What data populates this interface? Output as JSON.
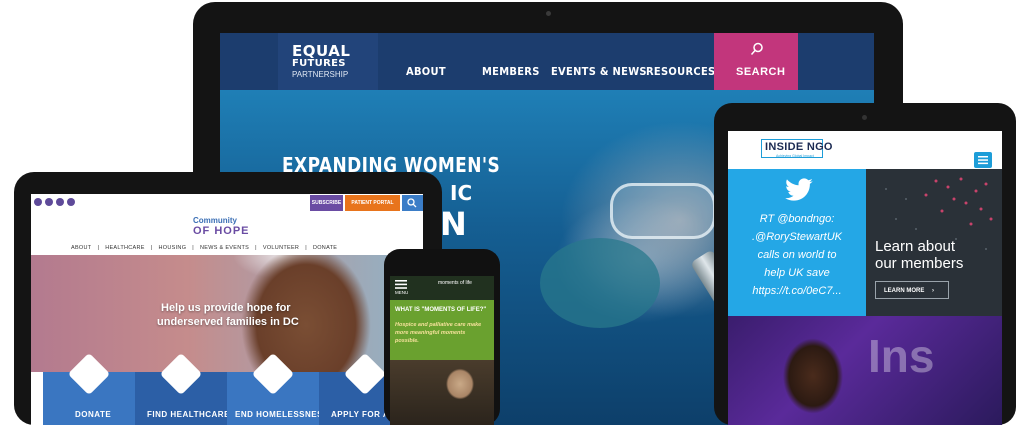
{
  "desktop": {
    "logo_line1": "EQUAL",
    "logo_line2": "FUTURES",
    "logo_line3": "PARTNERSHIP",
    "nav": [
      "ABOUT",
      "MEMBERS",
      "EVENTS & NEWS",
      "RESOURCES"
    ],
    "search_label": "SEARCH",
    "headline_line1": "EXPANDING WOMEN'S",
    "headline_line2": "IC",
    "headline_line3": "N",
    "colors": {
      "header": "#1c3d6e",
      "search": "#c2367c"
    }
  },
  "laptop": {
    "subscribe_label": "SUBSCRIBE",
    "portal_label": "PATIENT PORTAL",
    "logo_line1": "Community",
    "logo_line2": "OF HOPE",
    "nav": [
      "ABOUT",
      "|",
      "HEALTHCARE",
      "|",
      "HOUSING",
      "|",
      "NEWS & EVENTS",
      "|",
      "VOLUNTEER",
      "|",
      "DONATE"
    ],
    "headline_line1": "Help us provide hope for",
    "headline_line2": "underserved families in DC",
    "tiles": [
      {
        "label": "DONATE",
        "color": "#3a76c1"
      },
      {
        "label": "FIND HEALTHCARE",
        "color": "#2c5fa6"
      },
      {
        "label": "END HOMELESSNESS",
        "color": "#3a76c1"
      },
      {
        "label": "APPLY FOR A",
        "color": "#2c5fa6"
      }
    ]
  },
  "phone": {
    "menu_label": "MENU",
    "logo_text": "moments of life",
    "question": "WHAT IS \"MOMENTS OF LIFE?\"",
    "para_line1": "Hospice and palliative care make",
    "para_line2": "more meaningful moments",
    "para_line3": "possible."
  },
  "tablet": {
    "logo_text": "INSIDE NGO",
    "logo_sub": "Achieving Global Impact",
    "tweet_lines": [
      "RT @bondngo:",
      ".@RoryStewartUK",
      "calls on world to",
      "help UK save",
      "https://t.co/0eC7..."
    ],
    "learn_line1": "Learn about",
    "learn_line2": "our members",
    "learn_button": "LEARN MORE",
    "big_text": "Ins"
  }
}
